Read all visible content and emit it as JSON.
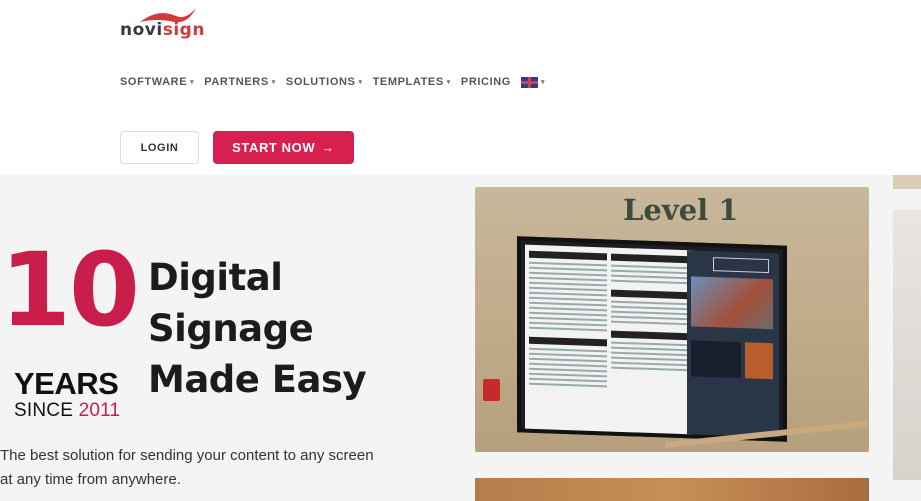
{
  "brand": {
    "name_part1": "novi",
    "name_part2": "sign"
  },
  "nav": {
    "items": [
      {
        "label": "SOFTWARE"
      },
      {
        "label": "PARTNERS"
      },
      {
        "label": "SOLUTIONS"
      },
      {
        "label": "TEMPLATES"
      },
      {
        "label": "PRICING"
      }
    ],
    "language_icon": "uk-flag-icon"
  },
  "actions": {
    "login": "LOGIN",
    "start": "START NOW",
    "start_arrow": "→"
  },
  "hero": {
    "years_number": "10",
    "years_word": "YEARS",
    "since_text": "SINCE",
    "since_year": "2011",
    "headline_line1": "Digital",
    "headline_line2": "Signage",
    "headline_line3": "Made Easy",
    "subtext_line1": "The best solution for sending your content to any screen",
    "subtext_line2": "at any time from anywhere."
  },
  "photo": {
    "sign_text": "Level 1"
  },
  "colors": {
    "accent": "#d6204f",
    "hero_red": "#c91e4a",
    "hero_bg": "#f4f4f5"
  }
}
